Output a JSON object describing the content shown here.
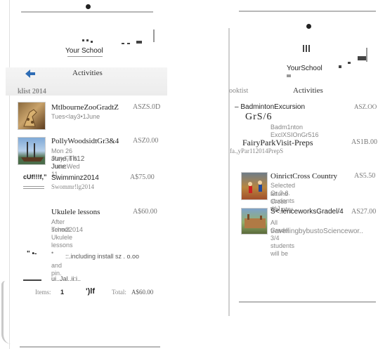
{
  "left": {
    "school": "Your School",
    "title": "Activities",
    "tab": "klist 2014",
    "items": [
      {
        "title": "MtlbourneZooGradtZ",
        "price": "ASZS.0D",
        "sub": "Tues<lay3•1June"
      },
      {
        "title": "PollyWoodsidtGr3&4",
        "price": "ASZ0.00",
        "sub": "Mon 26 May,Fri 6 Juoe.Wed 11",
        "sub2": "June,Th12 June"
      },
      {
        "badge": "cUf!!!f,”",
        "title": "Swimminz2014",
        "price": "A$75.00",
        "sub": "Swommr!lg2014"
      },
      {
        "title": "Ukulele lessons",
        "price": "A$60.00",
        "sub": "After school Ukulele lessons •",
        "sub2": "Term22014"
      },
      {
        "lead": "\" •-",
        "title": "::.including install sz . o.oo",
        "sub": "and pin."
      },
      {
        "title": "ui..Jal..ii:i.."
      }
    ],
    "footer": {
      "items_label": "Items:",
      "items_value": "1",
      "mark": "')lf",
      "total_label": "Total:",
      "total_value": "A$60.00"
    }
  },
  "right": {
    "school": "YourSchool",
    "title": "Activities",
    "tab": "ooktist",
    "items": [
      {
        "title": "– BadmintonExcursion",
        "price": "ASZ.OO",
        "big": "GrS/6",
        "sub": "Badm1nton ExclXSIOnGr516"
      },
      {
        "title": "FairyParkVisit-Preps",
        "price": "AS1B.00",
        "sub": "fa.,yPar112014PrepS"
      },
      {
        "title": "OinrictCross Country",
        "price": "AS5.50",
        "sub": "Selected Gr 3-6. students w\\J",
        "sub2": "attend Cross Country"
      },
      {
        "title": "S<.ienceworksGradel/4",
        "price": "AS27.00",
        "sub": "All Grade 3/4 students will be",
        "sub2": "travellingbybustoSciencewor.."
      }
    ]
  },
  "colors": {
    "accent": "#2f6db5",
    "text": "#222222",
    "muted": "#888888"
  }
}
